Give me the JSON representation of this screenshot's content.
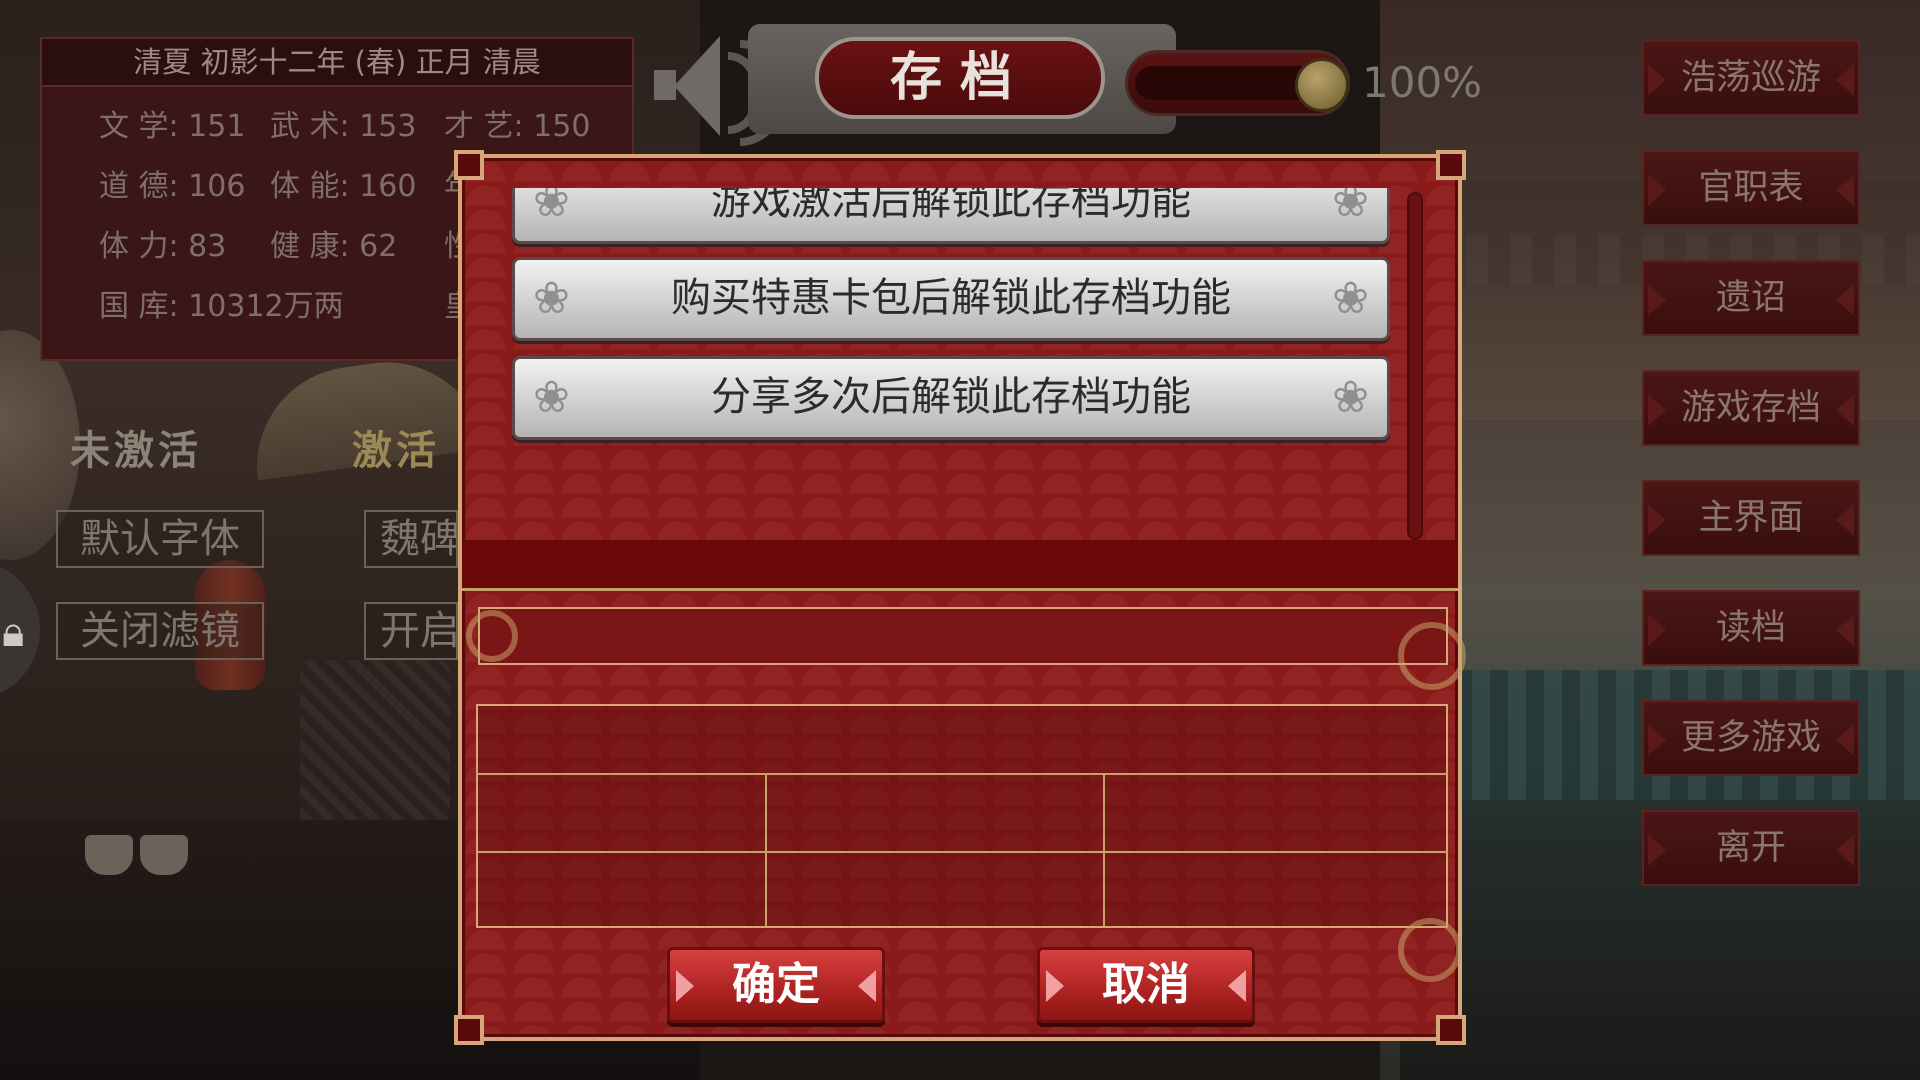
{
  "stats": {
    "header": "清夏 初影十二年 (春) 正月 清晨",
    "rows": [
      [
        "文 学: 151",
        "武 术: 153",
        "才 艺: 150"
      ],
      [
        "道 德: 106",
        "体 能: 160",
        "年"
      ],
      [
        "体 力: 83",
        "健 康: 62",
        "性"
      ],
      [
        "国 库: 10312万两",
        "",
        "皇"
      ]
    ]
  },
  "left_options": {
    "inactive_label": "未激活",
    "active_label": "激活",
    "font_default": "默认字体",
    "font_wei": "魏碑",
    "filter_off": "关闭滤镜",
    "filter_on": "开启"
  },
  "header": {
    "title": "存档",
    "volume_text": "100%",
    "volume_fraction": 1.0
  },
  "dialog": {
    "slots": [
      "游戏激活后解锁此存档功能",
      "购买特惠卡包后解锁此存档功能",
      "分享多次后解锁此存档功能"
    ],
    "save_name_value": "",
    "confirm_label": "确定",
    "cancel_label": "取消"
  },
  "menu": [
    "浩荡巡游",
    "官职表",
    "遗诏",
    "游戏存档",
    "主界面",
    "读档",
    "更多游戏",
    "离开"
  ],
  "icons": {
    "speaker": "speaker-icon",
    "lock": "lock-icon",
    "scroll_ornament": "scroll-ornament-icon"
  },
  "colors": {
    "dialog_red": "#8a1a1a",
    "gold_border": "#d6a77a",
    "button_red": "#b02424",
    "slot_silver": "#d6d6d6"
  }
}
